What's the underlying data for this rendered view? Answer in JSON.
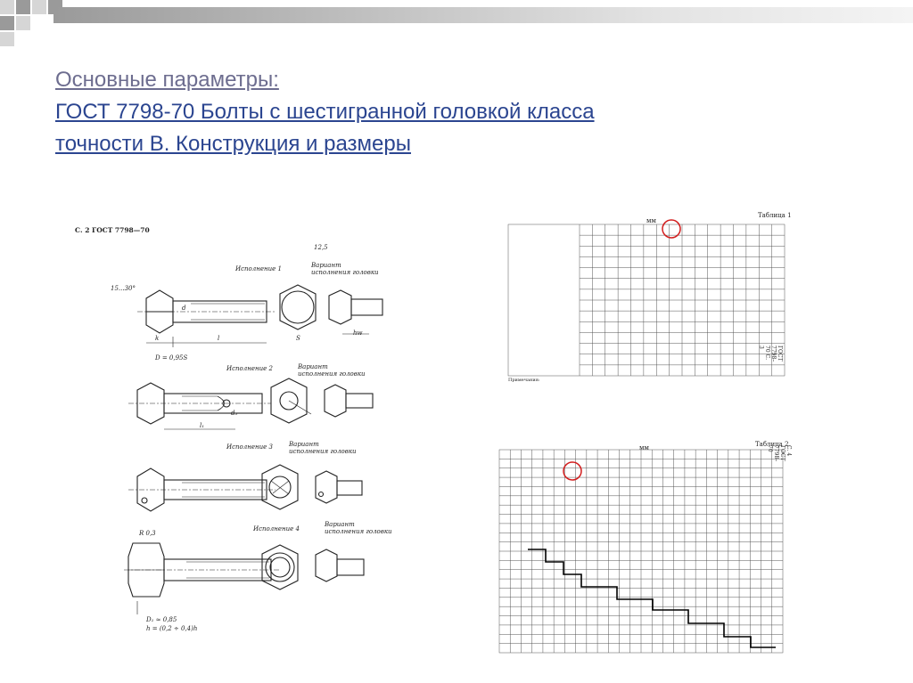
{
  "slide": {
    "title_line1": "Основные параметры:",
    "title_line2": "ГОСТ 7798-70 Болты с шестигранной головкой класса",
    "title_line3": "точности В. Конструкция и размеры"
  },
  "drawing": {
    "header": "С. 2 ГОСТ 7798—70",
    "labels": {
      "isp1": "Исполнение 1",
      "var_head_1": "Вариант исполнения головки",
      "isp2": "Исполнение 2",
      "var_head_2": "Вариант исполнения головки",
      "isp3": "Исполнение 3",
      "var_head_3": "Вариант исполнения головки",
      "isp4": "Исполнение 4",
      "var_head_4": "Вариант исполнения головки",
      "formula1": "D = 0,95S",
      "formula2": "D₁ ≈ 0,85",
      "formula3": "h = (0,2 ÷ 0,4)h",
      "r_label": "R 0,3",
      "rough": "12,5",
      "angle": "15...30°",
      "l": "l",
      "l1": "l₁",
      "s": "S",
      "k": "k",
      "d": "d",
      "d3": "d₃",
      "hw": "hw"
    }
  },
  "table1": {
    "title": "Таблица 1",
    "unit": "мм",
    "side_text": "ГОСТ 7798–70 С. 3",
    "notes_title": "Примечания:"
  },
  "table2": {
    "title": "Таблица 2",
    "unit": "мм",
    "side_text": "С. 4 ГОСТ 7798–70"
  },
  "colors": {
    "title": "#2b4590",
    "highlight_circle": "#d21e1e",
    "deco_dark": "#9a9a9a",
    "deco_light": "#d6d6d6"
  }
}
